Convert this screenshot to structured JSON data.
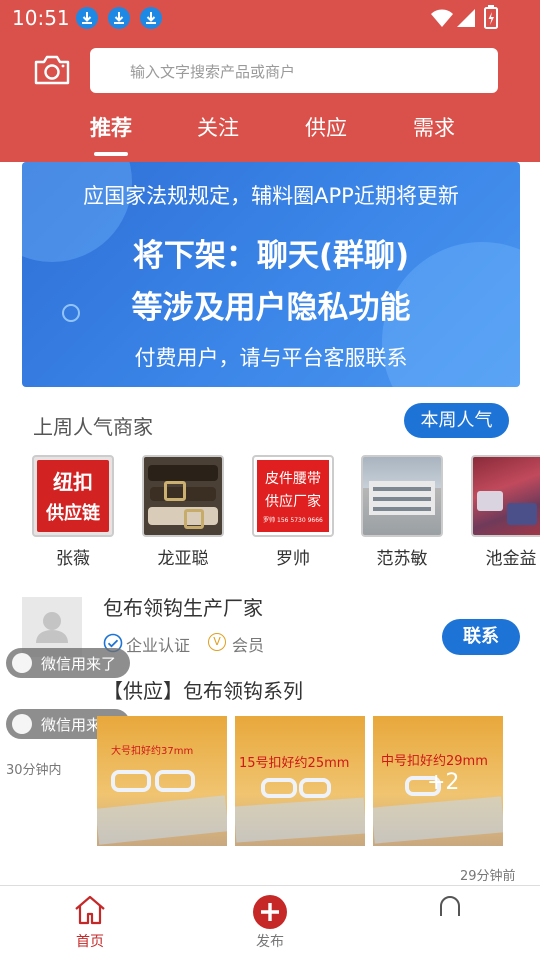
{
  "status_bar": {
    "time": "10:51"
  },
  "search": {
    "placeholder": "输入文字搜索产品或商户"
  },
  "tabs": [
    {
      "label": "推荐",
      "active": true
    },
    {
      "label": "关注",
      "active": false
    },
    {
      "label": "供应",
      "active": false
    },
    {
      "label": "需求",
      "active": false
    }
  ],
  "banner": {
    "line1": "应国家法规规定，辅料圈APP近期将更新",
    "line2": "将下架：聊天(群聊)",
    "line3": "等涉及用户隐私功能",
    "line4": "付费用户，请与平台客服联系"
  },
  "popular": {
    "title": "上周人气商家",
    "week_button": "本周人气",
    "merchants": [
      {
        "name": "张薇",
        "logo_text_1": "纽扣",
        "logo_text_2": "供应链"
      },
      {
        "name": "龙亚聪"
      },
      {
        "name": "罗帅",
        "logo_text_1": "皮件腰带",
        "logo_text_2": "供应厂家",
        "logo_small": "罗帅 156 5730 9666"
      },
      {
        "name": "范苏敏"
      },
      {
        "name": "池金益"
      }
    ]
  },
  "post": {
    "merchant_name": "包布领钩生产厂家",
    "badge_verified": "企业认证",
    "badge_member": "会员",
    "member_icon_letter": "V",
    "contact_button": "联系",
    "title": "【供应】包布领钩系列",
    "wechat_toast_1": "微信用来了",
    "wechat_toast_2": "微信用来了",
    "time_within": "30分钟内",
    "time_ago": "29分钟前",
    "photos": [
      {
        "caption": "大号扣好约37mm"
      },
      {
        "caption": "15号扣好约25mm"
      },
      {
        "caption": "中号扣好约29mm",
        "overlay": "+2"
      }
    ]
  },
  "bottom_nav": [
    {
      "label": "首页",
      "active": true
    },
    {
      "label": "发布",
      "active": false
    }
  ],
  "colors": {
    "primary_red": "#d9514a",
    "accent_blue": "#1e74d6",
    "nav_active_red": "#c62828"
  }
}
